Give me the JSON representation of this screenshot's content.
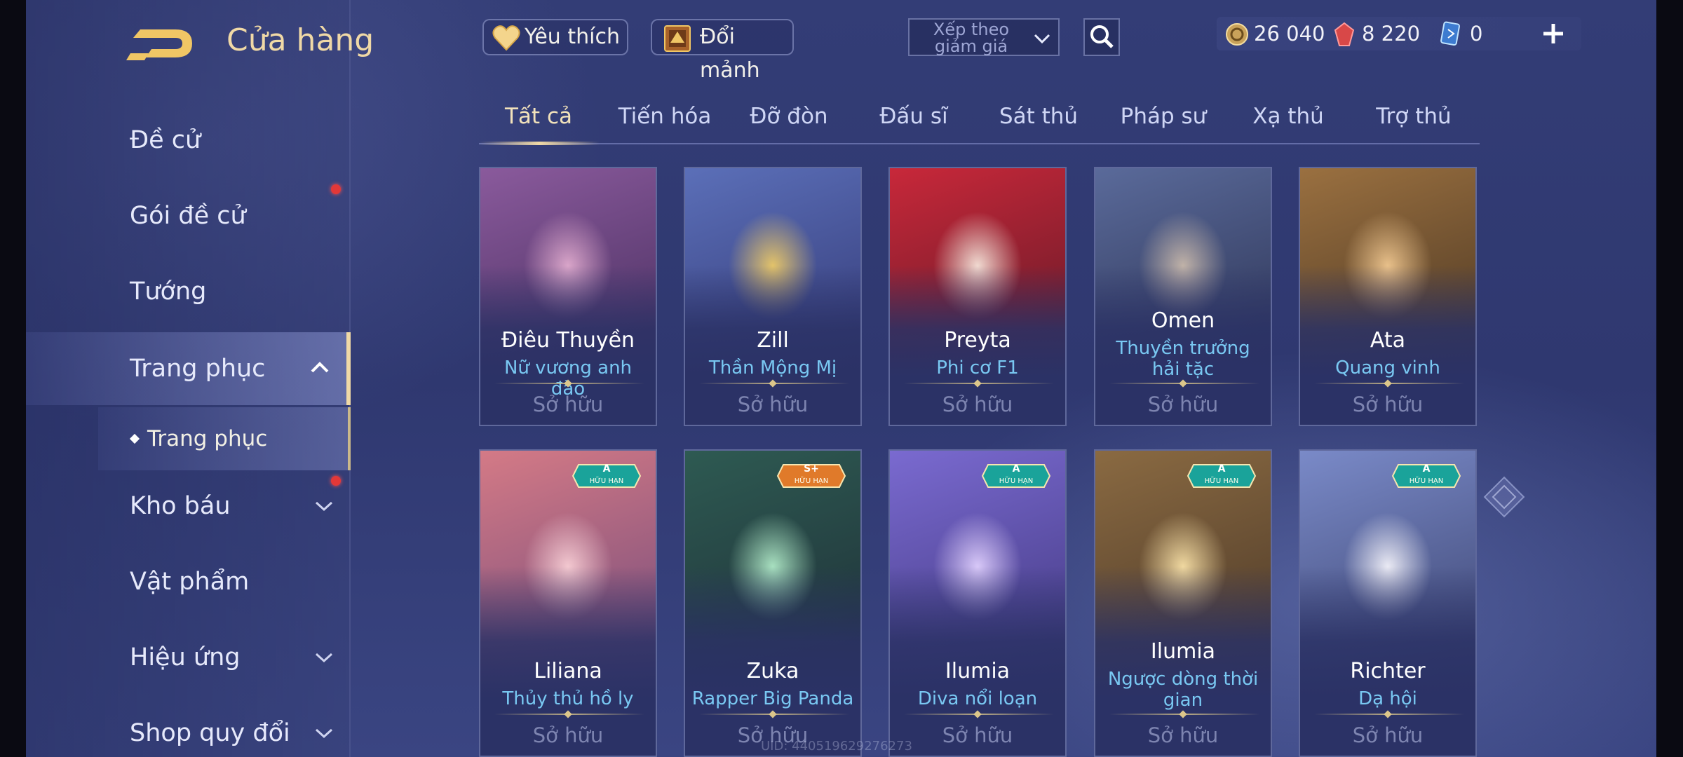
{
  "header": {
    "title": "Cửa hàng",
    "favorites_label": "Yêu thích",
    "exchange_label": "Đổi mảnh",
    "sort_label": "Xếp theo giảm giá",
    "currencies": [
      {
        "name": "gold",
        "icon": "gold-coin-icon",
        "value": "26 040"
      },
      {
        "name": "ruby",
        "icon": "ruby-gem-icon",
        "value": "8 220"
      },
      {
        "name": "voucher",
        "icon": "voucher-card-icon",
        "value": "0"
      }
    ]
  },
  "sidebar": {
    "items": [
      {
        "label": "Đề cử"
      },
      {
        "label": "Gói đề cử"
      },
      {
        "label": "Tướng"
      },
      {
        "label": "Trang phục"
      },
      {
        "label": "Kho báu"
      },
      {
        "label": "Vật phẩm"
      },
      {
        "label": "Hiệu ứng"
      },
      {
        "label": "Shop quy đổi"
      }
    ],
    "sub_item": "Trang phục"
  },
  "tabs": [
    "Tất cả",
    "Tiến hóa",
    "Đỡ đòn",
    "Đấu sĩ",
    "Sát thủ",
    "Pháp sư",
    "Xạ thủ",
    "Trợ thủ"
  ],
  "cards": [
    {
      "hero": "Điêu Thuyền",
      "skin": "Nữ vương anh đào",
      "status": "Sở hữu"
    },
    {
      "hero": "Zill",
      "skin": "Thần Mộng Mị",
      "status": "Sở hữu"
    },
    {
      "hero": "Preyta",
      "skin": "Phi cơ F1",
      "status": "Sở hữu"
    },
    {
      "hero": "Omen",
      "skin": "Thuyền trưởng hải tặc",
      "status": "Sở hữu"
    },
    {
      "hero": "Ata",
      "skin": "Quang vinh",
      "status": "Sở hữu"
    },
    {
      "hero": "Liliana",
      "skin": "Thủy thủ hồ ly",
      "status": "Sở hữu",
      "badge": "A",
      "badge_sub": "HỮU HẠN"
    },
    {
      "hero": "Zuka",
      "skin": "Rapper Big Panda",
      "status": "Sở hữu",
      "badge": "S+",
      "badge_sub": "HỮU HẠN"
    },
    {
      "hero": "Ilumia",
      "skin": "Diva nổi loạn",
      "status": "Sở hữu",
      "badge": "A",
      "badge_sub": "HỮU HẠN"
    },
    {
      "hero": "Ilumia",
      "skin": "Ngược dòng thời gian",
      "status": "Sở hữu",
      "badge": "A",
      "badge_sub": "HỮU HẠN"
    },
    {
      "hero": "Richter",
      "skin": "Dạ hội",
      "status": "Sở hữu",
      "badge": "A",
      "badge_sub": "HỮU HẠN"
    }
  ],
  "uid": "UID: 440519629276273",
  "colors": {
    "accent_gold": "#f0d9a6",
    "skin_blue": "#79c8f2",
    "badge_teal": "#1aa39a",
    "badge_orange": "#e07a2a",
    "notification_red": "#e33838"
  }
}
